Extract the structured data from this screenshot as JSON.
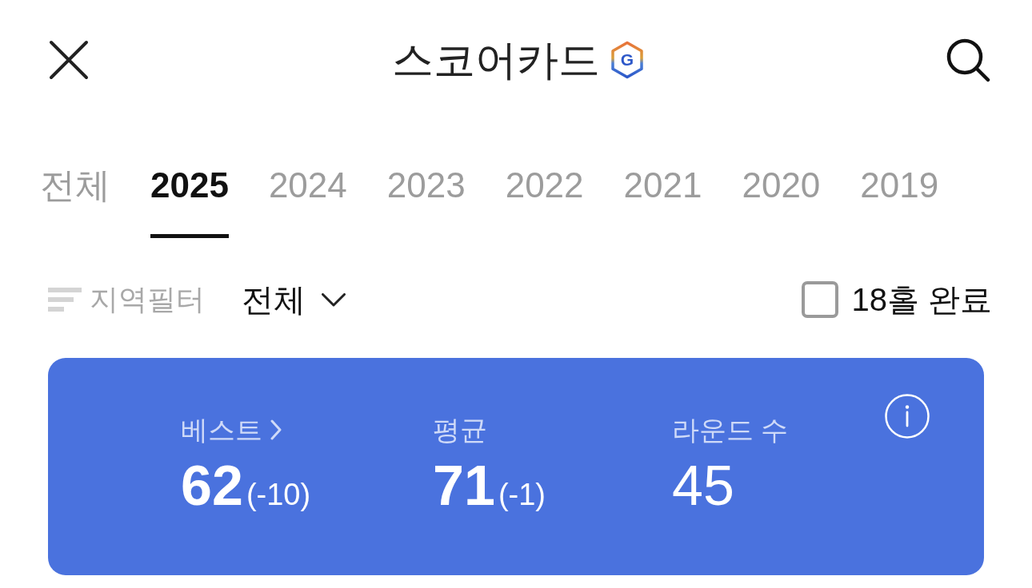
{
  "header": {
    "title": "스코어카드",
    "badge": "G"
  },
  "tabs": [
    {
      "label": "전체",
      "selected": false
    },
    {
      "label": "2025",
      "selected": true
    },
    {
      "label": "2024",
      "selected": false
    },
    {
      "label": "2023",
      "selected": false
    },
    {
      "label": "2022",
      "selected": false
    },
    {
      "label": "2021",
      "selected": false
    },
    {
      "label": "2020",
      "selected": false
    },
    {
      "label": "2019",
      "selected": false
    }
  ],
  "filter": {
    "label": "지역필터",
    "value": "전체"
  },
  "complete_filter": {
    "label": "18홀 완료",
    "checked": false
  },
  "summary": {
    "stats": [
      {
        "kind": "link",
        "label": "베스트",
        "value": "62",
        "delta": "(-10)",
        "bold": true
      },
      {
        "kind": "plain",
        "label": "평균",
        "value": "71",
        "delta": "(-1)",
        "bold": true
      },
      {
        "kind": "plain",
        "label": "라운드 수",
        "value": "45",
        "bold": false
      }
    ]
  }
}
